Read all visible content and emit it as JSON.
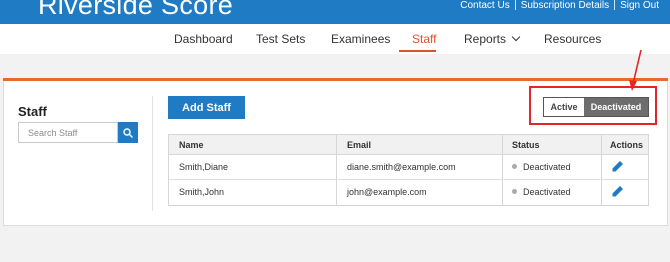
{
  "brand": {
    "title": "Riverside Score"
  },
  "top_links": [
    "Contact Us",
    "Subscription Details",
    "Sign Out"
  ],
  "nav": {
    "items": [
      "Dashboard",
      "Test Sets",
      "Examinees",
      "Staff",
      "Reports",
      "Resources"
    ],
    "active": "Staff"
  },
  "sidebar": {
    "title": "Staff",
    "search_placeholder": "Search Staff"
  },
  "toolbar": {
    "add_staff_label": "Add Staff",
    "toggle": {
      "active_label": "Active",
      "deactivated_label": "Deactivated",
      "selected": "Deactivated"
    }
  },
  "table": {
    "columns": [
      "Name",
      "Email",
      "Status",
      "Actions"
    ],
    "rows": [
      {
        "name": "Smith,Diane",
        "email": "diane.smith@example.com",
        "status": "Deactivated"
      },
      {
        "name": "Smith,John",
        "email": "john@example.com",
        "status": "Deactivated"
      }
    ]
  },
  "colors": {
    "brand_blue": "#1e7bc4",
    "active_orange": "#d9542b",
    "annotation_red": "#e3262a",
    "toggle_selected": "#6d6d6d"
  },
  "icons": {
    "search": "search-icon",
    "edit": "pencil-icon",
    "reports_dropdown": "chevron-down-icon",
    "status": "status-dot-icon"
  }
}
